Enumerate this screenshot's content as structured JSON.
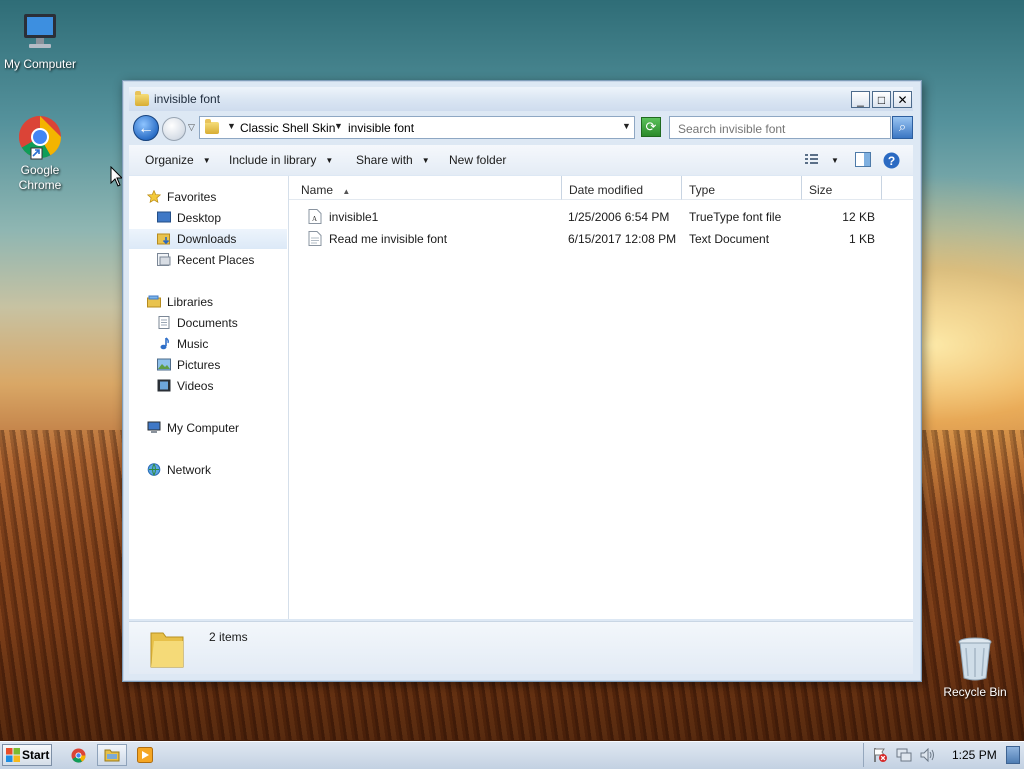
{
  "desktop": {
    "icons": [
      {
        "label": "My Computer"
      },
      {
        "label_line1": "Google",
        "label_line2": "Chrome"
      },
      {
        "label": "Recycle Bin"
      }
    ]
  },
  "window": {
    "title": "invisible font",
    "controls": {
      "minimize": "_",
      "maximize": "□",
      "close": "✕"
    },
    "address": {
      "crumbs": [
        "Classic Shell Skin",
        "invisible font"
      ]
    },
    "search": {
      "placeholder": "Search invisible font"
    },
    "toolbar": {
      "organize": "Organize",
      "include_in_library": "Include in library",
      "share_with": "Share with",
      "new_folder": "New folder"
    },
    "nav": {
      "favorites": "Favorites",
      "favorites_items": [
        "Desktop",
        "Downloads",
        "Recent Places"
      ],
      "libraries": "Libraries",
      "libraries_items": [
        "Documents",
        "Music",
        "Pictures",
        "Videos"
      ],
      "my_computer": "My Computer",
      "network": "Network"
    },
    "columns": {
      "name": "Name",
      "date_modified": "Date modified",
      "type": "Type",
      "size": "Size"
    },
    "files": [
      {
        "name": "invisible1",
        "date": "1/25/2006 6:54 PM",
        "type": "TrueType font file",
        "size": "12 KB"
      },
      {
        "name": "Read me invisible font",
        "date": "6/15/2017 12:08 PM",
        "type": "Text Document",
        "size": "1 KB"
      }
    ],
    "details": {
      "item_count": "2 items"
    }
  },
  "taskbar": {
    "start_label": "Start",
    "clock": "1:25 PM"
  },
  "colors": {
    "selection": "#dce9f7",
    "window_frame": "#dde8f4",
    "accent_blue": "#2c6fc7"
  }
}
